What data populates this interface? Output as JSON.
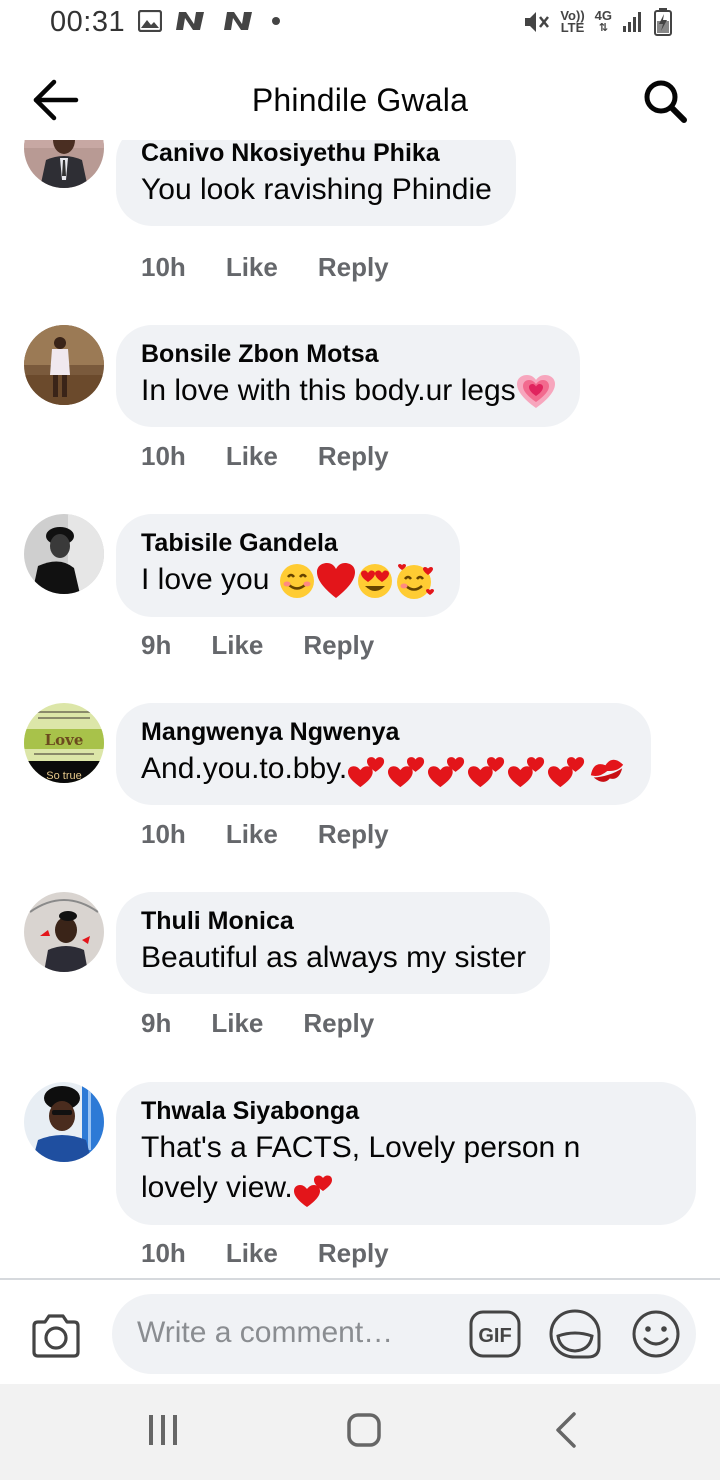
{
  "status_bar": {
    "time": "00:31",
    "left_icons": [
      "gallery-icon",
      "n-app-icon",
      "n-app-icon",
      "dot-icon"
    ],
    "network_label_top": "Vo))",
    "network_label_bottom": "LTE",
    "network_type": "4G",
    "right_icons": [
      "mute-icon",
      "signal-icon",
      "battery-charging-icon"
    ]
  },
  "header": {
    "title": "Phindile Gwala",
    "back_icon": "back-arrow-icon",
    "search_icon": "search-icon"
  },
  "comments": [
    {
      "name": "Canivo Nkosiyethu Phika",
      "text": "You look ravishing Phindie",
      "emojis": [],
      "time": "10h",
      "like": "Like",
      "reply": "Reply"
    },
    {
      "name": "Bonsile Zbon Motsa",
      "text": "In love with this body.ur legs",
      "emojis": [
        "growing-heart"
      ],
      "time": "10h",
      "like": "Like",
      "reply": "Reply"
    },
    {
      "name": "Tabisile Gandela",
      "text": "I love you ",
      "emojis": [
        "smiling-face",
        "red-heart",
        "heart-eyes",
        "smiling-hearts"
      ],
      "time": "9h",
      "like": "Like",
      "reply": "Reply"
    },
    {
      "name": "Mangwenya Ngwenya",
      "text": "And.you.to.bby.",
      "emojis": [
        "two-hearts",
        "two-hearts",
        "two-hearts",
        "two-hearts",
        "two-hearts",
        "two-hearts",
        "kiss-mark"
      ],
      "time": "10h",
      "like": "Like",
      "reply": "Reply"
    },
    {
      "name": "Thuli Monica",
      "text": "Beautiful as always my sister",
      "emojis": [],
      "time": "9h",
      "like": "Like",
      "reply": "Reply"
    },
    {
      "name": "Thwala Siyabonga",
      "text_line1": "That's a FACTS, Lovely person n",
      "text_line2": "lovely view.",
      "emojis": [
        "two-hearts"
      ],
      "time": "10h",
      "like": "Like",
      "reply": "Reply"
    }
  ],
  "avatar_text": {
    "mangwenya": "Love",
    "mangwenya_caption": "So true"
  },
  "composer": {
    "placeholder": "Write a comment…",
    "camera_icon": "camera-icon",
    "gif_label": "GIF",
    "sticker_icon": "sticker-icon",
    "emoji_icon": "emoji-icon"
  },
  "nav_bar": {
    "icons": [
      "recent-apps-icon",
      "home-icon",
      "back-icon"
    ]
  },
  "colors": {
    "bubble": "#f0f2f5",
    "meta_text": "#65676b",
    "name_text": "#050505",
    "placeholder": "#8a8d91",
    "navbar": "#f2f2f2"
  }
}
